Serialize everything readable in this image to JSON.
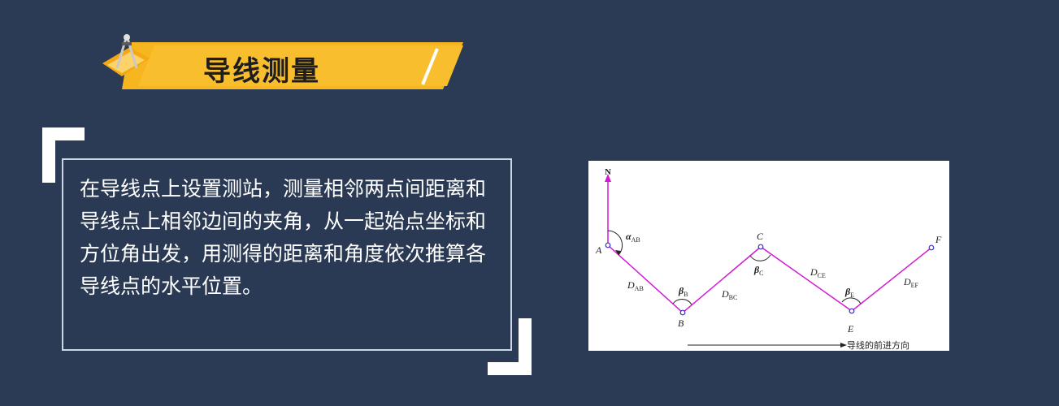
{
  "title": "导线测量",
  "description": "在导线点上设置测站，测量相邻两点间距离和导线点上相邻边间的夹角，从一起始点坐标和方位角出发，用测得的距离和角度依次推算各导线点的水平位置。",
  "diagram": {
    "north": "N",
    "points": {
      "A": "A",
      "B": "B",
      "C": "C",
      "E": "E",
      "F": "F"
    },
    "alpha": {
      "sym": "α",
      "sub": "AB"
    },
    "distances": [
      {
        "sym": "D",
        "sub": "AB"
      },
      {
        "sym": "D",
        "sub": "BC"
      },
      {
        "sym": "D",
        "sub": "CE"
      },
      {
        "sym": "D",
        "sub": "EF"
      }
    ],
    "angles": [
      {
        "sym": "β",
        "sub": "B"
      },
      {
        "sym": "β",
        "sub": "C"
      },
      {
        "sym": "β",
        "sub": "E"
      }
    ],
    "direction_label": "导线的前进方向",
    "line_color": "#d21ad2"
  },
  "colors": {
    "background": "#2c3b55",
    "accent": "#f7b520"
  }
}
